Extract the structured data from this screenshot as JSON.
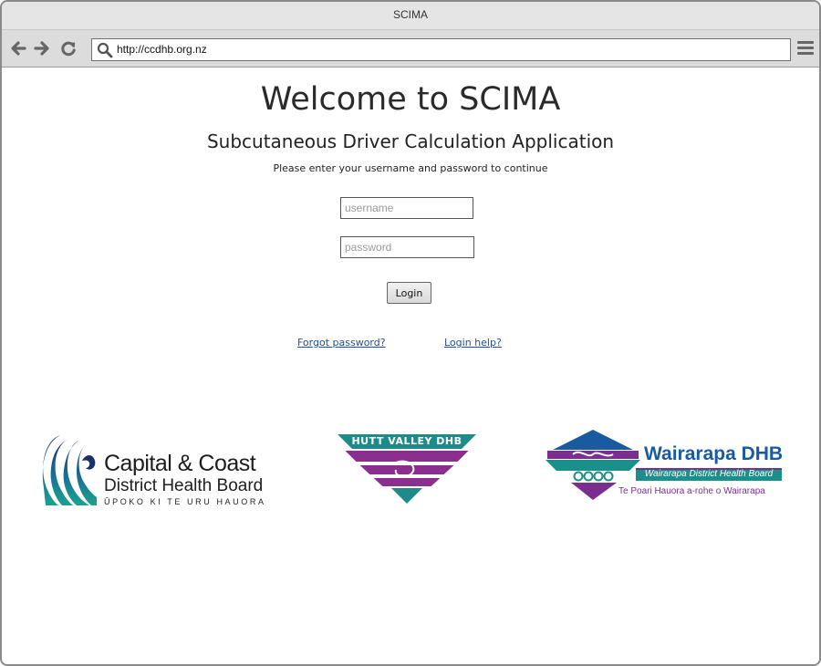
{
  "window": {
    "title": "SCIMA"
  },
  "toolbar": {
    "url": "http://ccdhb.org.nz",
    "icons": {
      "back": "arrow-left-icon",
      "forward": "arrow-right-icon",
      "reload": "reload-icon",
      "search": "search-icon",
      "menu": "hamburger-menu-icon"
    }
  },
  "page": {
    "heading": "Welcome to SCIMA",
    "subheading": "Subcutaneous Driver Calculation Application",
    "instructions": "Please enter your username and password to continue",
    "username_placeholder": "username",
    "password_placeholder": "password",
    "username_value": "",
    "password_value": "",
    "login_label": "Login",
    "forgot_password": "Forgot password?",
    "login_help": "Login help?"
  },
  "logos": {
    "ccdhb": {
      "line1": "Capital & Coast",
      "line2": "District Health Board",
      "line3": "ŪPOKO KI TE URU HAUORA"
    },
    "hutt": {
      "name": "HUTT VALLEY DHB"
    },
    "wairarapa": {
      "name": "Wairarapa DHB",
      "line2": "Wairarapa District Health Board",
      "line3": "Te Poari Hauora a-rohe o Wairarapa"
    }
  },
  "colors": {
    "link": "#1f4e9c",
    "ccdhb_navy": "#1b2f6b",
    "ccdhb_teal": "#1aa38c",
    "hutt_teal": "#1f8a8a",
    "hutt_purple": "#8a2f8e",
    "wairarapa_blue": "#1a5aa0",
    "wairarapa_teal": "#1b8f8a",
    "wairarapa_purple": "#7a2f8e"
  }
}
